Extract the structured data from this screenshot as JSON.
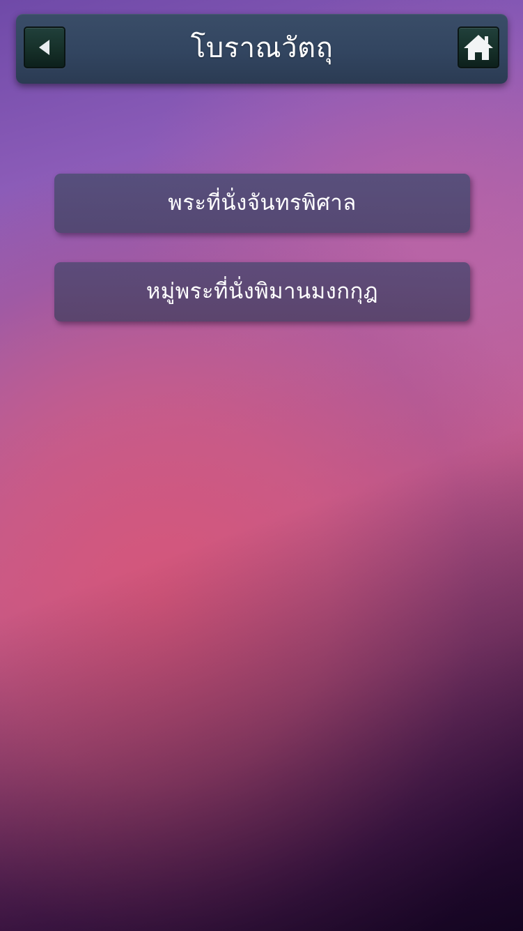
{
  "header": {
    "title": "โบราณวัตถุ",
    "back_icon": "chevron-left-icon",
    "home_icon": "home-icon"
  },
  "menu": {
    "items": [
      {
        "label": "พระที่นั่งจันทรพิศาล"
      },
      {
        "label": "หมู่พระที่นั่งพิมานมงกกุฎ"
      }
    ]
  },
  "colors": {
    "header_bg": "#324560",
    "icon_button_bg": "#163029",
    "menu_button_bg": "#524e78",
    "background_top": "#6f4aa8",
    "background_middle": "#d6567a",
    "background_bottom": "#22092f"
  }
}
